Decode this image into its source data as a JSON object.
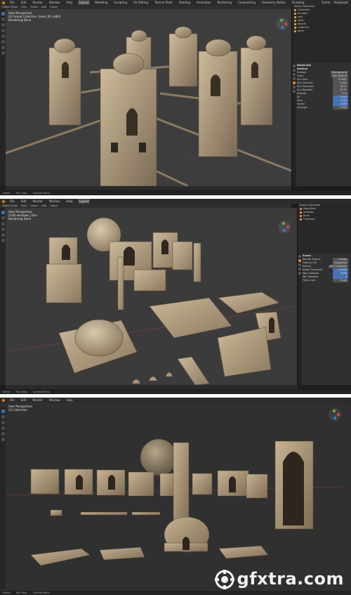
{
  "panels": [
    {
      "menu": [
        "File",
        "Edit",
        "Render",
        "Window",
        "Help"
      ],
      "workspaces": [
        "Layout",
        "Modeling",
        "Sculpting",
        "UV Editing",
        "Texture Paint",
        "Shading",
        "Animation",
        "Rendering",
        "Compositing",
        "Geometry Nodes",
        "Scripting"
      ],
      "active_workspace": "Layout",
      "scene": "Scene",
      "view_layer": "ViewLayer",
      "header": [
        "Object Mode",
        "View",
        "Select",
        "Add",
        "Object"
      ],
      "info": [
        "User Perspective",
        "(2) Scene Collection | base_02_mdb3",
        "Rendering Done"
      ],
      "outliner_title": "Scene Collection",
      "outliner_items": [
        "Collection",
        "fountain",
        "roof",
        "sand",
        "facade",
        "Cube.001",
        "other"
      ],
      "props_title": "World.002",
      "props_section": "Surface",
      "props_rows": [
        {
          "label": "Surface",
          "value": "Background"
        },
        {
          "label": "Color",
          "value": "Sky Texture"
        },
        {
          "label": "Sun Size",
          "value": "0.545°"
        },
        {
          "label": "Sun Intensity",
          "value": "1.000"
        },
        {
          "label": "Sun Elevation",
          "value": "36.3°"
        },
        {
          "label": "Sun Rotation",
          "value": "57.9°"
        },
        {
          "label": "Altitude",
          "value": "0 m"
        },
        {
          "label": "Air",
          "value": "1.000"
        },
        {
          "label": "Dust",
          "value": "1.000"
        },
        {
          "label": "Ozone",
          "value": "1.000"
        },
        {
          "label": "Strength",
          "value": "0.350"
        }
      ],
      "status": [
        "Select",
        "Pan View",
        "Context Menu"
      ]
    },
    {
      "menu": [
        "File",
        "Edit",
        "Render",
        "Window",
        "Help"
      ],
      "active_workspace": "Layout",
      "header": [
        "Object Mode",
        "View",
        "Select",
        "Add",
        "Object"
      ],
      "info": [
        "User Perspective",
        "(218) windows | Sun",
        "Rendering Done"
      ],
      "outliner_title": "Scene Collection",
      "outliner_items": [
        "floor&tiles",
        "windows",
        "fonts",
        "Collection"
      ],
      "props_title": "Scene",
      "props_rows": [
        {
          "label": "Render Engine",
          "value": "Cycles"
        },
        {
          "label": "Feature Set",
          "value": "Supported"
        },
        {
          "label": "Device",
          "value": "GPU Compute"
        },
        {
          "label": "Noise Threshold",
          "value": "0.0100"
        },
        {
          "label": "Max Samples",
          "value": "4096"
        },
        {
          "label": "Min Samples",
          "value": "0"
        },
        {
          "label": "Time Limit",
          "value": "0 sec"
        }
      ],
      "status": [
        "Select",
        "Pan View",
        "Context Menu"
      ]
    },
    {
      "menu": [
        "File",
        "Edit",
        "Render",
        "Window",
        "Help"
      ],
      "info": [
        "User Perspective",
        "(2) Collection"
      ],
      "status": [
        "Select",
        "Pan View",
        "Context Menu"
      ]
    }
  ],
  "watermark": {
    "text": "gfxtra.com"
  },
  "colors": {
    "accent": "#e87d0d",
    "selected_blue": "#4772b3",
    "stone": "#b8a68a"
  }
}
